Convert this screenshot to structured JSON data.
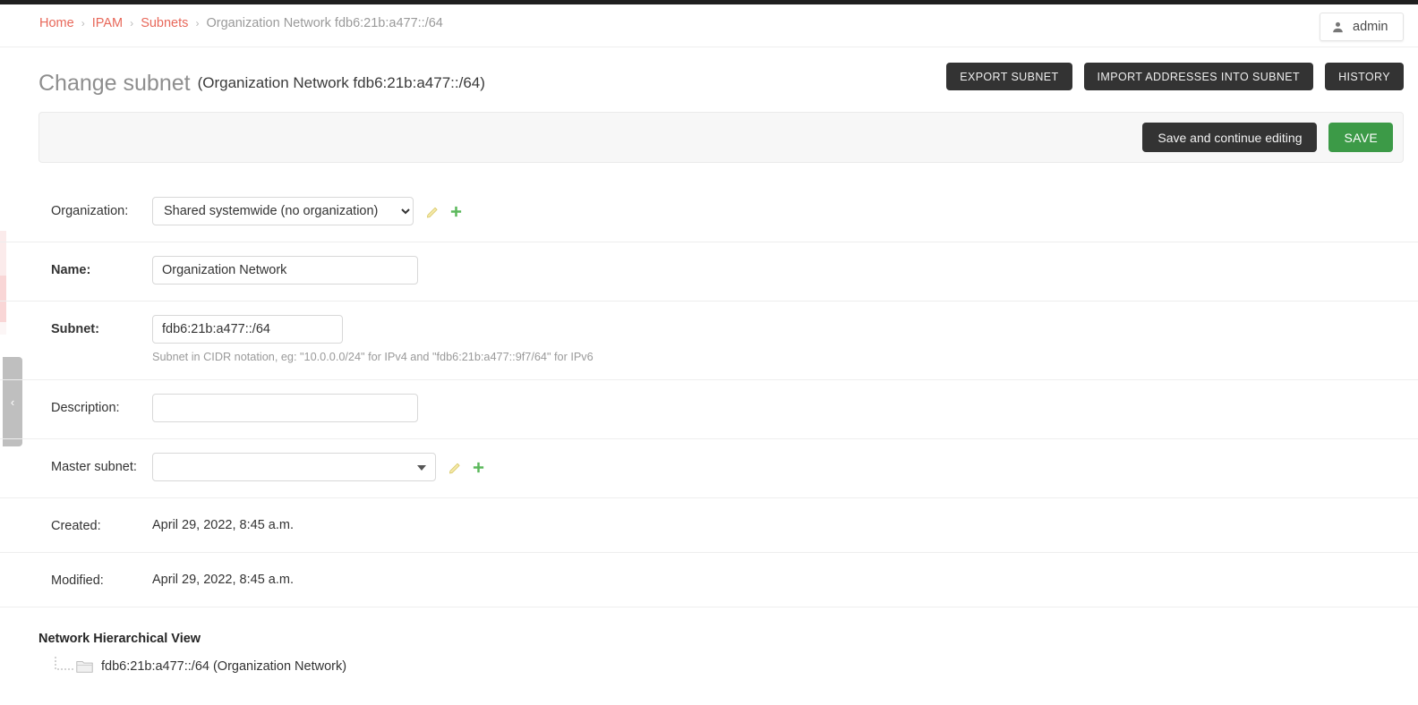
{
  "breadcrumb": {
    "items": [
      {
        "label": "Home",
        "link": true
      },
      {
        "label": "IPAM",
        "link": true
      },
      {
        "label": "Subnets",
        "link": true
      },
      {
        "label": "Organization Network fdb6:21b:a477::/64",
        "link": false
      }
    ],
    "separator": "›"
  },
  "user": {
    "name": "admin",
    "icon": "person-icon"
  },
  "header": {
    "title": "Change subnet",
    "object": "(Organization Network fdb6:21b:a477::/64)"
  },
  "object_tools": {
    "export": "EXPORT SUBNET",
    "import": "IMPORT ADDRESSES INTO SUBNET",
    "history": "HISTORY"
  },
  "submit_row": {
    "save_and_continue": "Save and continue editing",
    "save": "SAVE"
  },
  "form": {
    "organization": {
      "label": "Organization:",
      "value": "Shared systemwide (no organization)",
      "edit_icon": "pencil-icon",
      "add_icon": "plus-icon"
    },
    "name": {
      "label": "Name:",
      "value": "Organization Network",
      "placeholder": ""
    },
    "subnet": {
      "label": "Subnet:",
      "value": "fdb6:21b:a477::/64",
      "placeholder": "",
      "help": "Subnet in CIDR notation, eg: \"10.0.0.0/24\" for IPv4 and \"fdb6:21b:a477::9f7/64\" for IPv6"
    },
    "description": {
      "label": "Description:",
      "value": "",
      "placeholder": ""
    },
    "master_subnet": {
      "label": "Master subnet:",
      "value": "",
      "edit_icon": "pencil-icon",
      "add_icon": "plus-icon"
    },
    "created": {
      "label": "Created:",
      "value": "April 29, 2022, 8:45 a.m."
    },
    "modified": {
      "label": "Modified:",
      "value": "April 29, 2022, 8:45 a.m."
    }
  },
  "hierarchy": {
    "title": "Network Hierarchical View",
    "nodes": [
      {
        "label": "fdb6:21b:a477::/64 (Organization Network)",
        "icon": "folder-icon"
      }
    ]
  },
  "sidebar": {
    "collapse_glyph": "‹"
  },
  "colors": {
    "link": "#e8685a",
    "dark_button": "#333333",
    "save_green": "#3c9a47",
    "panel_gray": "#f7f7f7",
    "pencil_yellow": "#f2e08a",
    "plus_green": "#5cb85c"
  }
}
